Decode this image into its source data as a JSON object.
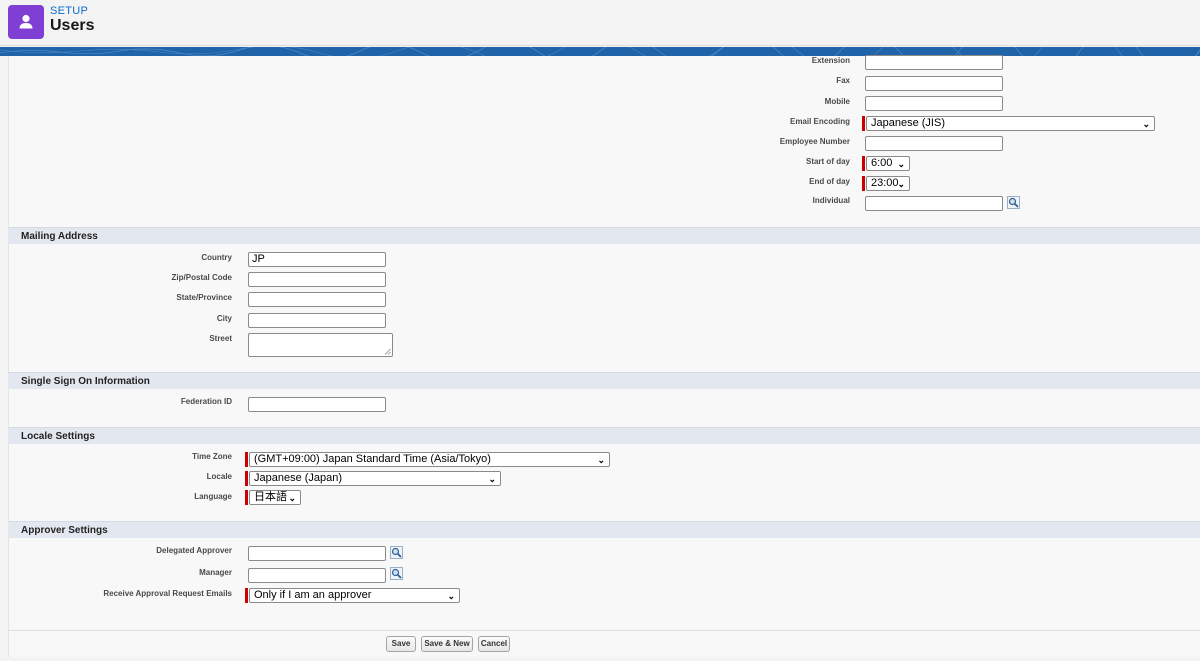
{
  "header": {
    "setup_label": "SETUP",
    "title": "Users",
    "icon": "user-icon",
    "accent_color": "#7f3fd4"
  },
  "top_fields": {
    "extension": {
      "label": "Extension",
      "value": ""
    },
    "fax": {
      "label": "Fax",
      "value": ""
    },
    "mobile": {
      "label": "Mobile",
      "value": ""
    },
    "email_encoding": {
      "label": "Email Encoding",
      "value": "Japanese (JIS)"
    },
    "employee_number": {
      "label": "Employee Number",
      "value": ""
    },
    "start_of_day": {
      "label": "Start of day",
      "value": "6:00"
    },
    "end_of_day": {
      "label": "End of day",
      "value": "23:00"
    },
    "individual": {
      "label": "Individual",
      "value": ""
    }
  },
  "mailing": {
    "title": "Mailing Address",
    "country": {
      "label": "Country",
      "value": "JP"
    },
    "zip": {
      "label": "Zip/Postal Code",
      "value": ""
    },
    "state": {
      "label": "State/Province",
      "value": ""
    },
    "city": {
      "label": "City",
      "value": ""
    },
    "street": {
      "label": "Street",
      "value": ""
    }
  },
  "sso": {
    "title": "Single Sign On Information",
    "federation_id": {
      "label": "Federation ID",
      "value": ""
    }
  },
  "locale": {
    "title": "Locale Settings",
    "time_zone": {
      "label": "Time Zone",
      "value": "(GMT+09:00) Japan Standard Time (Asia/Tokyo)"
    },
    "locale": {
      "label": "Locale",
      "value": "Japanese (Japan)"
    },
    "language": {
      "label": "Language",
      "value": "日本語"
    }
  },
  "approver": {
    "title": "Approver Settings",
    "delegated": {
      "label": "Delegated Approver",
      "value": ""
    },
    "manager": {
      "label": "Manager",
      "value": ""
    },
    "receive": {
      "label": "Receive Approval Request Emails",
      "value": "Only if I am an approver"
    }
  },
  "buttons": {
    "save": "Save",
    "save_new": "Save & New",
    "cancel": "Cancel"
  },
  "colors": {
    "required": "#cc0000",
    "section_bg": "#e3e8f0",
    "banner": "#1f63a8"
  }
}
